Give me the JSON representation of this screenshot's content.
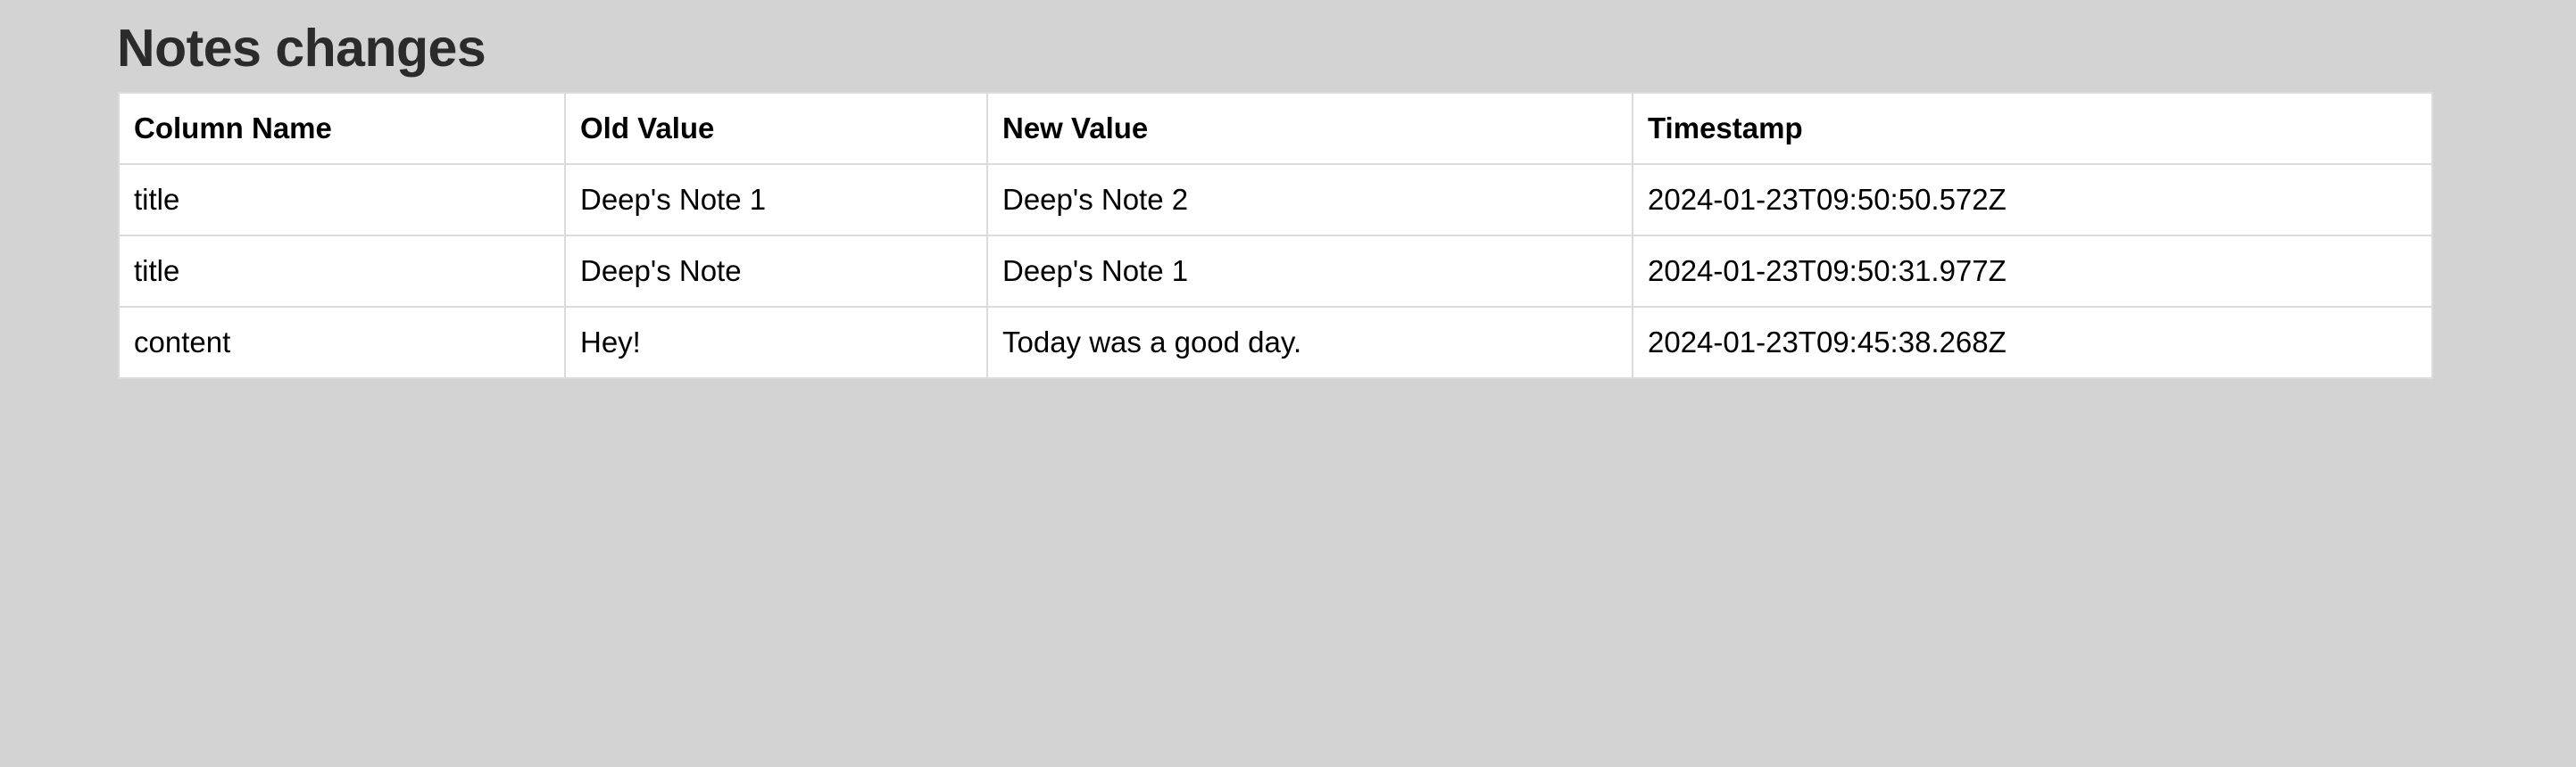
{
  "page": {
    "title": "Notes changes"
  },
  "table": {
    "headers": [
      "Column Name",
      "Old Value",
      "New Value",
      "Timestamp"
    ],
    "rows": [
      [
        "title",
        "Deep's Note 1",
        "Deep's Note 2",
        "2024-01-23T09:50:50.572Z"
      ],
      [
        "title",
        "Deep's Note",
        "Deep's Note 1",
        "2024-01-23T09:50:31.977Z"
      ],
      [
        "content",
        "Hey!",
        "Today was a good day.",
        "2024-01-23T09:45:38.268Z"
      ]
    ]
  },
  "colors": {
    "background": "#d3d3d3",
    "table_background": "#ffffff",
    "border": "#dcdcdc",
    "title_text": "#2b2b2b"
  }
}
